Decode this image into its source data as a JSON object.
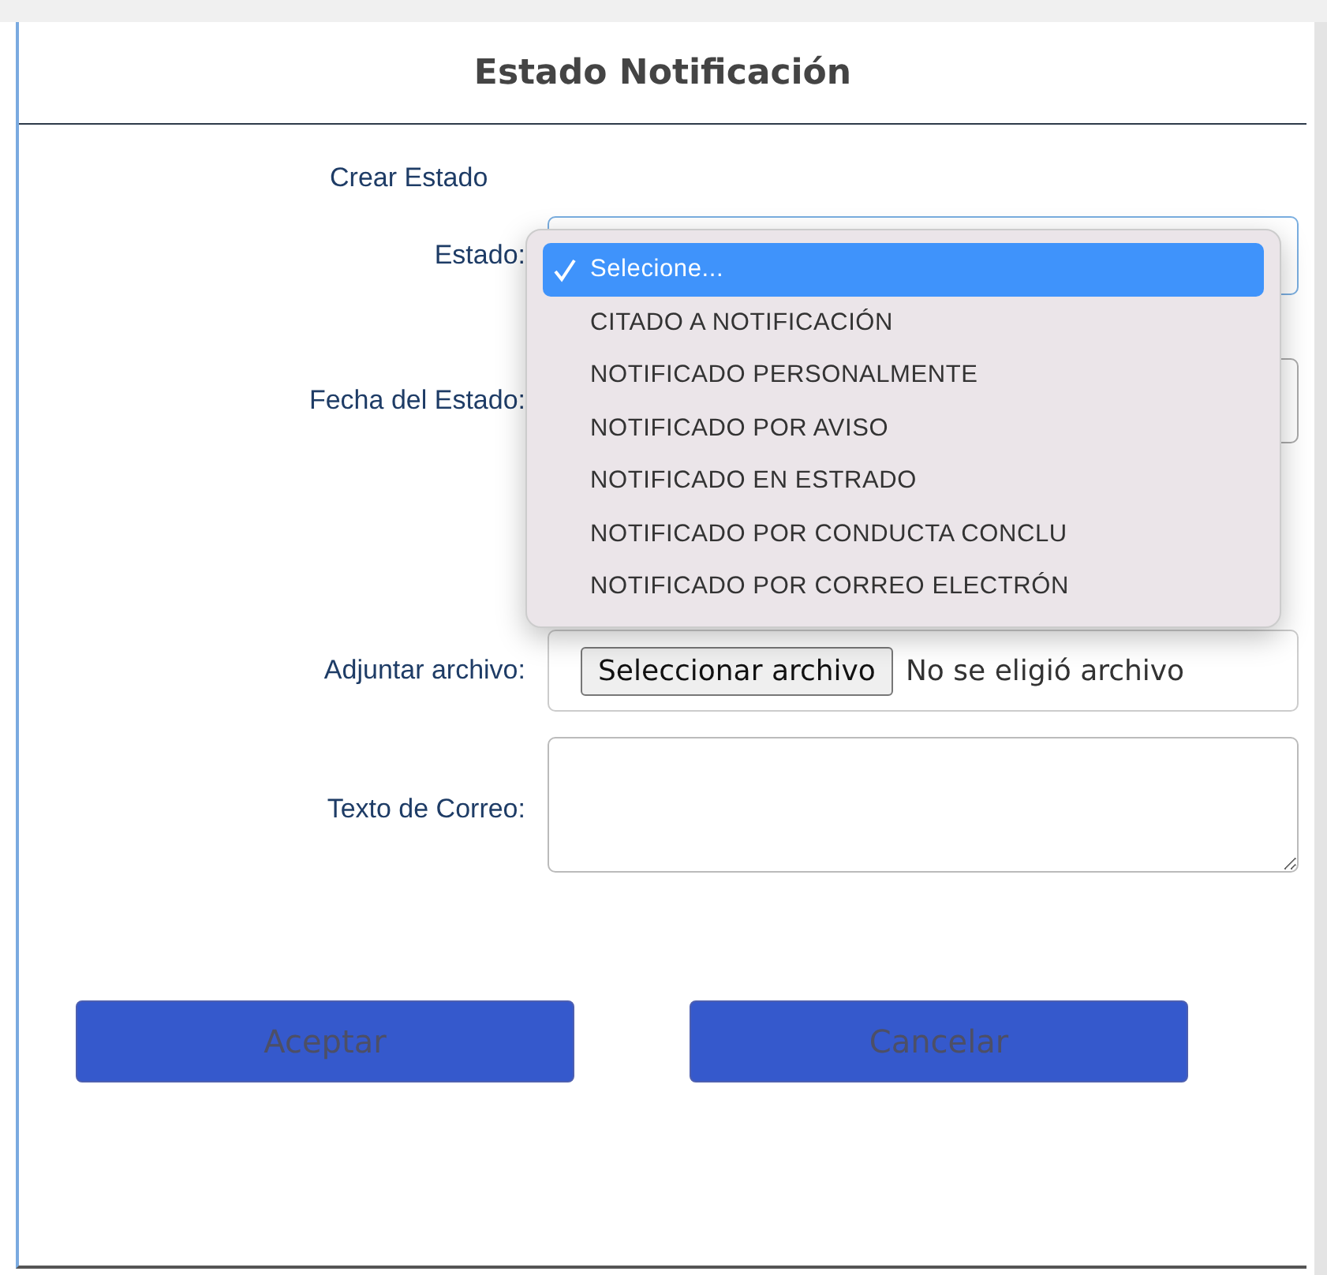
{
  "dialog": {
    "title": "Estado Notificación",
    "section": "Crear Estado"
  },
  "fields": [
    {
      "kind": "select",
      "label": "Estado:"
    },
    {
      "kind": "date",
      "label": "Fecha del Estado:"
    },
    {
      "kind": "file",
      "label": "Adjuntar archivo:",
      "button": "Seleccionar archivo",
      "status": "No se eligió archivo"
    },
    {
      "kind": "textarea",
      "label": "Texto de Correo:"
    }
  ],
  "dropdown": {
    "options": [
      {
        "label": "Selecione...",
        "selected": true
      },
      {
        "label": "CITADO A NOTIFICACIÓN",
        "selected": false
      },
      {
        "label": "NOTIFICADO PERSONALMENTE",
        "selected": false
      },
      {
        "label": "NOTIFICADO POR AVISO",
        "selected": false
      },
      {
        "label": "NOTIFICADO EN ESTRADO",
        "selected": false
      },
      {
        "label": "NOTIFICADO POR CONDUCTA CONCLU",
        "selected": false
      },
      {
        "label": "NOTIFICADO POR CORREO ELECTRÓN",
        "selected": false
      }
    ]
  },
  "buttons": [
    {
      "label": "Aceptar",
      "disabled": true
    },
    {
      "label": "Cancelar",
      "disabled": true
    }
  ]
}
